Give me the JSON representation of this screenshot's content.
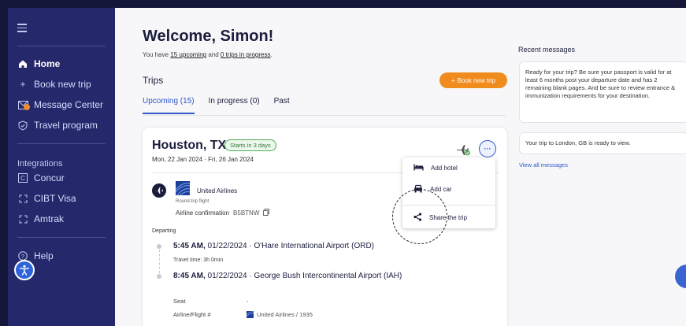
{
  "sidebar": {
    "nav": [
      {
        "label": "Home",
        "icon": "home-icon"
      },
      {
        "label": "Book new trip",
        "icon": "plus-icon"
      },
      {
        "label": "Message Center",
        "icon": "mail-icon"
      },
      {
        "label": "Travel program",
        "icon": "shield-check-icon"
      }
    ],
    "integrations_label": "Integrations",
    "integrations": [
      {
        "label": "Concur",
        "icon": "concur-icon"
      },
      {
        "label": "CIBT Visa",
        "icon": "expand-icon"
      },
      {
        "label": "Amtrak",
        "icon": "expand-icon"
      }
    ],
    "help": "Help"
  },
  "header": {
    "welcome": "Welcome, Simon!",
    "sub_prefix": "You have ",
    "upcoming_link": "15 upcoming",
    "sub_mid": " and ",
    "progress_link": "0 trips in progress",
    "sub_suffix": "."
  },
  "trips": {
    "title": "Trips",
    "book_button": "Book new trip",
    "tabs": [
      "Upcoming (15)",
      "In progress (0)",
      "Past"
    ]
  },
  "trip_card": {
    "city": "Houston, TX",
    "starts_badge": "Starts in 3 days",
    "dates": "Mon, 22 Jan 2024 · Fri, 26 Jan 2024",
    "airline": "United Airlines",
    "round_trip": "Round-trip flight",
    "confirmation_label": "Airline confirmation",
    "confirmation_code": "B5BTNW",
    "departing_label": "Departing",
    "segment1_time": "5:45 AM,",
    "segment1_rest": " 01/22/2024 · O'Hare International Airport (ORD)",
    "travel_time": "Travel time: 3h 0min",
    "segment2_time": "8:45 AM,",
    "segment2_rest": " 01/22/2024 · George Bush Intercontinental Airport (IAH)",
    "seat_label": "Seat",
    "seat_value": "-",
    "flight_label": "Airline/Flight #",
    "flight_value": "United Airlines / 1935"
  },
  "menu": {
    "items": [
      "Add hotel",
      "Add car",
      "Share the trip"
    ]
  },
  "messages": {
    "title": "Recent messages",
    "items": [
      "Ready for your trip? Be sure your passport is valid for at least 6 months post your departure date and has 2 remaining blank pages. And be sure to review entrance & immunization requirements for your destination.",
      "Your trip to London, GB is ready to view."
    ],
    "view_all": "View all messages"
  },
  "colors": {
    "sidebar": "#25286a",
    "accent_orange": "#f08c1e",
    "accent_blue": "#2f56c9",
    "badge_green": "#4caf50"
  }
}
